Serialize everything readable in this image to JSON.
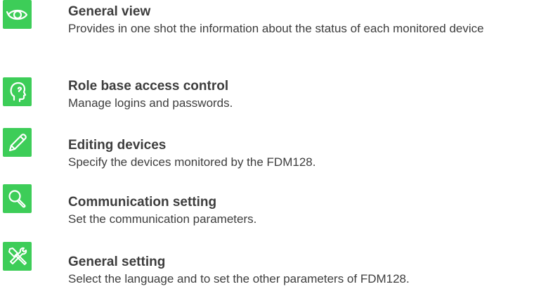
{
  "theme": {
    "icon_background": "#3dcd58",
    "icon_foreground": "#ffffff",
    "text_color": "#3d3d3d"
  },
  "features": [
    {
      "icon": "eye-icon",
      "title": "General view",
      "description": "Provides in one shot the information about the status of each monitored device"
    },
    {
      "icon": "user-profile-icon",
      "title": "Role base access control",
      "description": "Manage logins and passwords."
    },
    {
      "icon": "pen-icon",
      "title": "Editing devices",
      "description": "Specify the devices monitored by the FDM128."
    },
    {
      "icon": "search-icon",
      "title": "Communication setting",
      "description": "Set the communication parameters."
    },
    {
      "icon": "tools-icon",
      "title": "General setting",
      "description": "Select the language and to set the other parameters of FDM128."
    }
  ]
}
